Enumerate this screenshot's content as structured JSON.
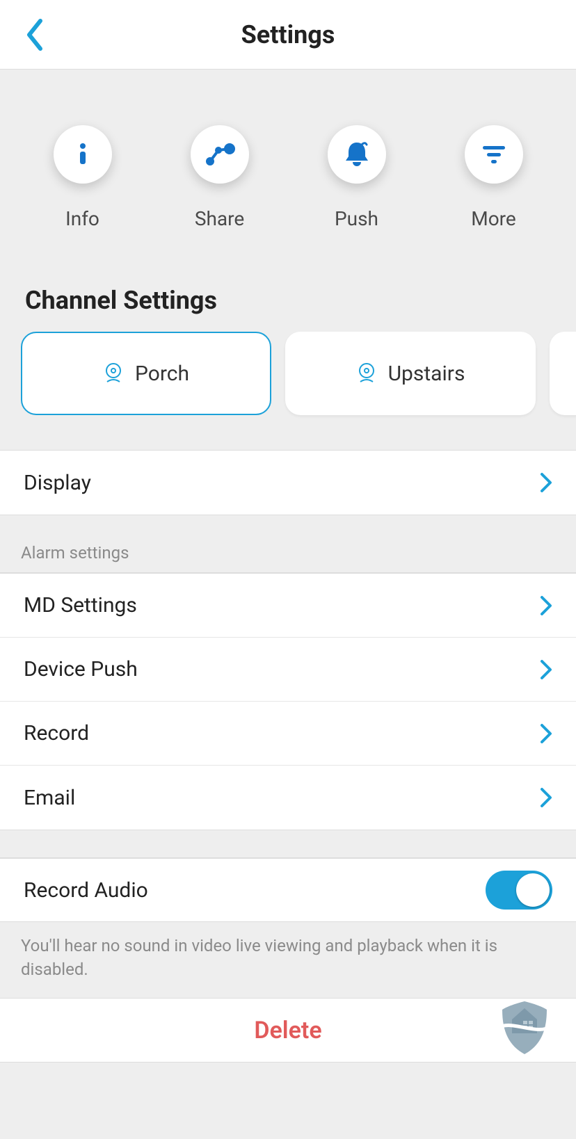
{
  "header": {
    "title": "Settings"
  },
  "actions": {
    "info": "Info",
    "share": "Share",
    "push": "Push",
    "more": "More"
  },
  "channel_section": {
    "title": "Channel Settings",
    "channels": [
      "Porch",
      "Upstairs"
    ]
  },
  "rows": {
    "display": "Display",
    "alarm_header": "Alarm settings",
    "md_settings": "MD Settings",
    "device_push": "Device Push",
    "record": "Record",
    "email": "Email",
    "record_audio": "Record Audio",
    "record_audio_on": true,
    "record_audio_help": "You'll hear no sound in video live viewing and playback when it is disabled.",
    "delete": "Delete"
  },
  "colors": {
    "accent": "#1ca1d9",
    "danger": "#e15a5a"
  }
}
